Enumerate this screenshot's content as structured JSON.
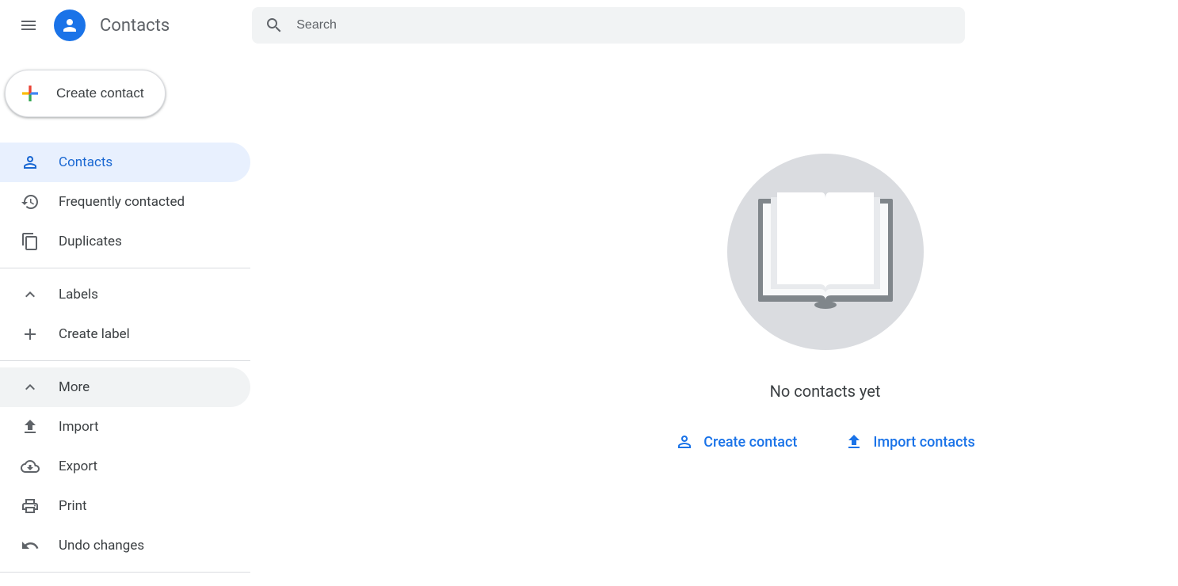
{
  "header": {
    "app_title": "Contacts",
    "search_placeholder": "Search"
  },
  "sidebar": {
    "create_label": "Create contact",
    "nav": {
      "contacts": "Contacts",
      "frequent": "Frequently contacted",
      "duplicates": "Duplicates"
    },
    "labels": {
      "header": "Labels",
      "create": "Create label"
    },
    "more": {
      "header": "More",
      "import": "Import",
      "export": "Export",
      "print": "Print",
      "undo": "Undo changes"
    }
  },
  "main": {
    "empty_text": "No contacts yet",
    "create_contact": "Create contact",
    "import_contacts": "Import contacts"
  }
}
